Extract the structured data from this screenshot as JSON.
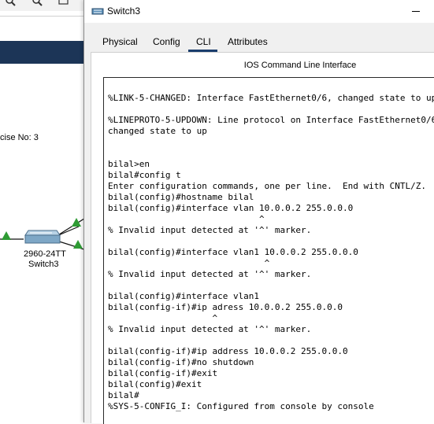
{
  "background": {
    "note": "cise No: 3",
    "device": {
      "model": "2960-24TT",
      "name": "Switch3"
    },
    "colors": {
      "band": "#1c3557",
      "link_green": "#2e9b34"
    }
  },
  "window": {
    "title": "Switch3",
    "icon": "switch-icon",
    "tabs": [
      {
        "label": "Physical"
      },
      {
        "label": "Config"
      },
      {
        "label": "CLI"
      },
      {
        "label": "Attributes"
      }
    ],
    "active_tab": "CLI",
    "panel_title": "IOS Command Line Interface"
  },
  "cli": {
    "lines": [
      "%LINK-5-CHANGED: Interface FastEthernet0/6, changed state to up",
      "",
      "%LINEPROTO-5-UPDOWN: Line protocol on Interface FastEthernet0/6,",
      "changed state to up",
      "",
      "",
      "bilal>en",
      "bilal#config t",
      "Enter configuration commands, one per line.  End with CNTL/Z.",
      "bilal(config)#hostname bilal",
      "bilal(config)#interface vlan 10.0.0.2 255.0.0.0",
      "                             ^",
      "% Invalid input detected at '^' marker.",
      "",
      "bilal(config)#interface vlan1 10.0.0.2 255.0.0.0",
      "                              ^",
      "% Invalid input detected at '^' marker.",
      "",
      "bilal(config)#interface vlan1",
      "bilal(config-if)#ip adress 10.0.0.2 255.0.0.0",
      "                    ^",
      "% Invalid input detected at '^' marker.",
      "",
      "bilal(config-if)#ip address 10.0.0.2 255.0.0.0",
      "bilal(config-if)#no shutdown",
      "bilal(config-if)#exit",
      "bilal(config)#exit",
      "bilal#",
      "%SYS-5-CONFIG_I: Configured from console by console"
    ]
  }
}
